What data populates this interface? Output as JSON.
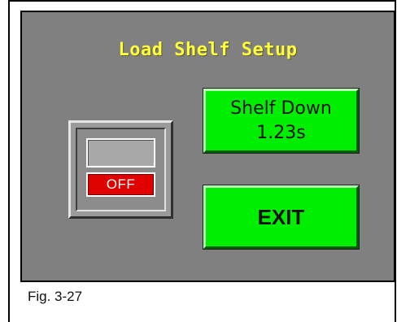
{
  "screen": {
    "title": "Load Shelf Setup",
    "switch": {
      "on_label": "",
      "off_label": "OFF",
      "state": "off"
    },
    "shelf_button": {
      "line1": "Shelf Down",
      "line2": "1.23s"
    },
    "exit_button": {
      "label": "EXIT"
    }
  },
  "caption": "Fig. 3-27",
  "colors": {
    "panel": "#808080",
    "title": "#ffff40",
    "button_green": "#00ee00",
    "off_red": "#e00000"
  }
}
